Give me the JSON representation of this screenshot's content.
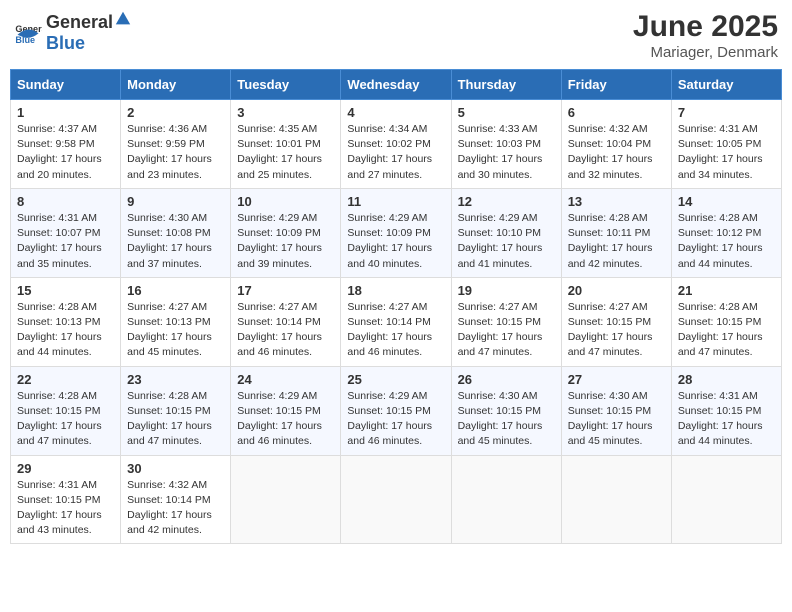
{
  "header": {
    "logo_general": "General",
    "logo_blue": "Blue",
    "title": "June 2025",
    "location": "Mariager, Denmark"
  },
  "columns": [
    "Sunday",
    "Monday",
    "Tuesday",
    "Wednesday",
    "Thursday",
    "Friday",
    "Saturday"
  ],
  "weeks": [
    [
      {
        "day": "1",
        "sunrise": "Sunrise: 4:37 AM",
        "sunset": "Sunset: 9:58 PM",
        "daylight": "Daylight: 17 hours and 20 minutes."
      },
      {
        "day": "2",
        "sunrise": "Sunrise: 4:36 AM",
        "sunset": "Sunset: 9:59 PM",
        "daylight": "Daylight: 17 hours and 23 minutes."
      },
      {
        "day": "3",
        "sunrise": "Sunrise: 4:35 AM",
        "sunset": "Sunset: 10:01 PM",
        "daylight": "Daylight: 17 hours and 25 minutes."
      },
      {
        "day": "4",
        "sunrise": "Sunrise: 4:34 AM",
        "sunset": "Sunset: 10:02 PM",
        "daylight": "Daylight: 17 hours and 27 minutes."
      },
      {
        "day": "5",
        "sunrise": "Sunrise: 4:33 AM",
        "sunset": "Sunset: 10:03 PM",
        "daylight": "Daylight: 17 hours and 30 minutes."
      },
      {
        "day": "6",
        "sunrise": "Sunrise: 4:32 AM",
        "sunset": "Sunset: 10:04 PM",
        "daylight": "Daylight: 17 hours and 32 minutes."
      },
      {
        "day": "7",
        "sunrise": "Sunrise: 4:31 AM",
        "sunset": "Sunset: 10:05 PM",
        "daylight": "Daylight: 17 hours and 34 minutes."
      }
    ],
    [
      {
        "day": "8",
        "sunrise": "Sunrise: 4:31 AM",
        "sunset": "Sunset: 10:07 PM",
        "daylight": "Daylight: 17 hours and 35 minutes."
      },
      {
        "day": "9",
        "sunrise": "Sunrise: 4:30 AM",
        "sunset": "Sunset: 10:08 PM",
        "daylight": "Daylight: 17 hours and 37 minutes."
      },
      {
        "day": "10",
        "sunrise": "Sunrise: 4:29 AM",
        "sunset": "Sunset: 10:09 PM",
        "daylight": "Daylight: 17 hours and 39 minutes."
      },
      {
        "day": "11",
        "sunrise": "Sunrise: 4:29 AM",
        "sunset": "Sunset: 10:09 PM",
        "daylight": "Daylight: 17 hours and 40 minutes."
      },
      {
        "day": "12",
        "sunrise": "Sunrise: 4:29 AM",
        "sunset": "Sunset: 10:10 PM",
        "daylight": "Daylight: 17 hours and 41 minutes."
      },
      {
        "day": "13",
        "sunrise": "Sunrise: 4:28 AM",
        "sunset": "Sunset: 10:11 PM",
        "daylight": "Daylight: 17 hours and 42 minutes."
      },
      {
        "day": "14",
        "sunrise": "Sunrise: 4:28 AM",
        "sunset": "Sunset: 10:12 PM",
        "daylight": "Daylight: 17 hours and 44 minutes."
      }
    ],
    [
      {
        "day": "15",
        "sunrise": "Sunrise: 4:28 AM",
        "sunset": "Sunset: 10:13 PM",
        "daylight": "Daylight: 17 hours and 44 minutes."
      },
      {
        "day": "16",
        "sunrise": "Sunrise: 4:27 AM",
        "sunset": "Sunset: 10:13 PM",
        "daylight": "Daylight: 17 hours and 45 minutes."
      },
      {
        "day": "17",
        "sunrise": "Sunrise: 4:27 AM",
        "sunset": "Sunset: 10:14 PM",
        "daylight": "Daylight: 17 hours and 46 minutes."
      },
      {
        "day": "18",
        "sunrise": "Sunrise: 4:27 AM",
        "sunset": "Sunset: 10:14 PM",
        "daylight": "Daylight: 17 hours and 46 minutes."
      },
      {
        "day": "19",
        "sunrise": "Sunrise: 4:27 AM",
        "sunset": "Sunset: 10:15 PM",
        "daylight": "Daylight: 17 hours and 47 minutes."
      },
      {
        "day": "20",
        "sunrise": "Sunrise: 4:27 AM",
        "sunset": "Sunset: 10:15 PM",
        "daylight": "Daylight: 17 hours and 47 minutes."
      },
      {
        "day": "21",
        "sunrise": "Sunrise: 4:28 AM",
        "sunset": "Sunset: 10:15 PM",
        "daylight": "Daylight: 17 hours and 47 minutes."
      }
    ],
    [
      {
        "day": "22",
        "sunrise": "Sunrise: 4:28 AM",
        "sunset": "Sunset: 10:15 PM",
        "daylight": "Daylight: 17 hours and 47 minutes."
      },
      {
        "day": "23",
        "sunrise": "Sunrise: 4:28 AM",
        "sunset": "Sunset: 10:15 PM",
        "daylight": "Daylight: 17 hours and 47 minutes."
      },
      {
        "day": "24",
        "sunrise": "Sunrise: 4:29 AM",
        "sunset": "Sunset: 10:15 PM",
        "daylight": "Daylight: 17 hours and 46 minutes."
      },
      {
        "day": "25",
        "sunrise": "Sunrise: 4:29 AM",
        "sunset": "Sunset: 10:15 PM",
        "daylight": "Daylight: 17 hours and 46 minutes."
      },
      {
        "day": "26",
        "sunrise": "Sunrise: 4:30 AM",
        "sunset": "Sunset: 10:15 PM",
        "daylight": "Daylight: 17 hours and 45 minutes."
      },
      {
        "day": "27",
        "sunrise": "Sunrise: 4:30 AM",
        "sunset": "Sunset: 10:15 PM",
        "daylight": "Daylight: 17 hours and 45 minutes."
      },
      {
        "day": "28",
        "sunrise": "Sunrise: 4:31 AM",
        "sunset": "Sunset: 10:15 PM",
        "daylight": "Daylight: 17 hours and 44 minutes."
      }
    ],
    [
      {
        "day": "29",
        "sunrise": "Sunrise: 4:31 AM",
        "sunset": "Sunset: 10:15 PM",
        "daylight": "Daylight: 17 hours and 43 minutes."
      },
      {
        "day": "30",
        "sunrise": "Sunrise: 4:32 AM",
        "sunset": "Sunset: 10:14 PM",
        "daylight": "Daylight: 17 hours and 42 minutes."
      },
      null,
      null,
      null,
      null,
      null
    ]
  ]
}
